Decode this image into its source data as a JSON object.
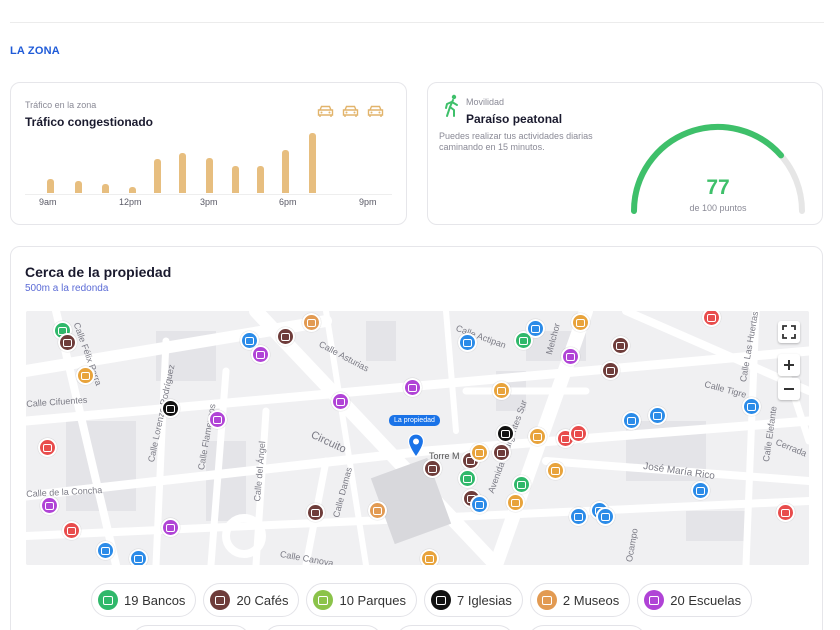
{
  "section": {
    "title": "LA ZONA"
  },
  "traffic": {
    "label": "Tráfico en la zona",
    "title": "Tráfico congestionado",
    "bar_color": "#e7be7f",
    "ticks": [
      "9am",
      "12pm",
      "3pm",
      "6pm",
      "9pm"
    ],
    "levels": [
      0.22,
      0.2,
      0.15,
      0.1,
      0.55,
      0.65,
      0.56,
      0.43,
      0.43,
      0.7,
      0.97
    ]
  },
  "mobility": {
    "label": "Movilidad",
    "title": "Paraíso peatonal",
    "description": "Puedes realizar tus actividades diarias caminando en 15 minutos.",
    "score": "77",
    "score_sub": "de 100 puntos",
    "score_fraction": 0.77,
    "accent": "#3ec06a"
  },
  "nearby": {
    "title": "Cerca de la propiedad",
    "subtitle": "500m a la redonda",
    "map": {
      "property_label": "La propiedad",
      "place_label": "Torre M",
      "streets": [
        "Calle Félix Parra",
        "Calle Lorenzo Rodríguez",
        "Calle Flamencos",
        "Calle del Ángel",
        "Circuito",
        "Calle Damas",
        "Calle Asturias",
        "Calle Actipan",
        "Avenida Insurgentes Sur",
        "Calle Tigre",
        "Calle Las Huertas",
        "Calle Elefante",
        "José María Rico",
        "Cerrada",
        "Calle Canova",
        "Calle Cifuentes",
        "Calle de la Concha",
        "Melchor",
        "Ocampo"
      ]
    },
    "categories": [
      {
        "label": "19 Bancos",
        "color": "#2fb86a"
      },
      {
        "label": "20 Cafés",
        "color": "#6e3c3a"
      },
      {
        "label": "10 Parques",
        "color": "#8bc34a"
      },
      {
        "label": "7 Iglesias",
        "color": "#111111"
      },
      {
        "label": "2 Museos",
        "color": "#e29a52"
      },
      {
        "label": "20 Escuelas",
        "color": "#b043d6"
      }
    ]
  }
}
